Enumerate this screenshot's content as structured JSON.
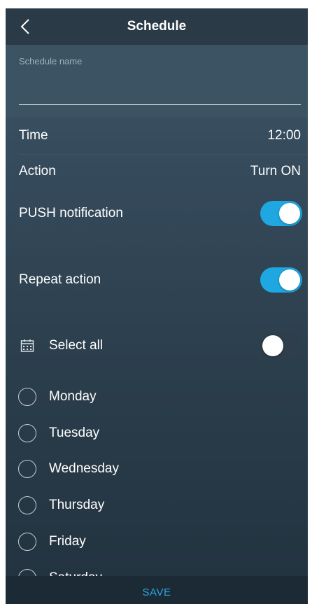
{
  "header": {
    "title": "Schedule",
    "back_icon": "chevron-left-icon"
  },
  "schedule_name": {
    "label": "Schedule name",
    "value": "",
    "placeholder": ""
  },
  "settings": {
    "time_label": "Time",
    "time_value": "12:00",
    "action_label": "Action",
    "action_value": "Turn ON"
  },
  "push_notification": {
    "label": "PUSH notification",
    "enabled": true
  },
  "repeat_action": {
    "label": "Repeat action",
    "enabled": true
  },
  "select_all": {
    "label": "Select all",
    "icon": "calendar-icon",
    "enabled": false
  },
  "days": [
    {
      "label": "Monday",
      "checked": false
    },
    {
      "label": "Tuesday",
      "checked": false
    },
    {
      "label": "Wednesday",
      "checked": false
    },
    {
      "label": "Thursday",
      "checked": false
    },
    {
      "label": "Friday",
      "checked": false
    },
    {
      "label": "Saturday",
      "checked": false
    }
  ],
  "footer": {
    "save_label": "SAVE"
  },
  "colors": {
    "accent": "#1ea7e1",
    "save_text": "#2aa7e0",
    "header_bg": "#2a3a46"
  }
}
